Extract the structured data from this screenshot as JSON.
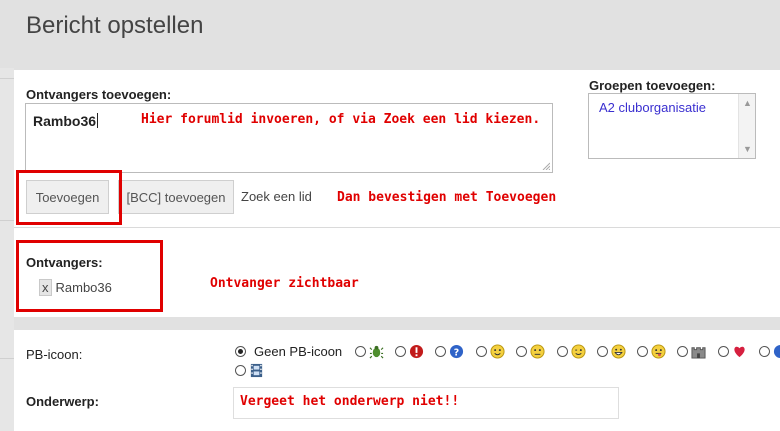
{
  "header": {
    "title": "Bericht opstellen"
  },
  "recipients_form": {
    "label": "Ontvangers toevoegen:",
    "input_value": "Rambo36",
    "add_button": "Toevoegen",
    "bcc_button": "[BCC] toevoegen",
    "search_link": "Zoek een lid"
  },
  "groups": {
    "label": "Groepen toevoegen:",
    "options": [
      "A2 cluborganisatie"
    ]
  },
  "recipients_list": {
    "label": "Ontvangers:",
    "items": [
      {
        "remove": "x",
        "name": "Rambo36"
      }
    ]
  },
  "annotations": {
    "input_hint": "Hier forumlid invoeren, of via Zoek een lid kiezen.",
    "confirm_hint": "Dan bevestigen met Toevoegen",
    "visible_hint": "Ontvanger zichtbaar",
    "subject_hint": "Vergeet het onderwerp niet!!",
    "accent_color": "#e00000"
  },
  "pm_icon": {
    "label": "PB-icoon:",
    "no_icon_label": "Geen PB-icoon",
    "selected": "Geen PB-icoon",
    "icons": [
      "bug-icon",
      "exclamation-icon",
      "question-icon",
      "smile-icon",
      "neutral-icon",
      "wink-icon",
      "grin-icon",
      "tongue-icon",
      "castle-icon",
      "heart-icon",
      "info-icon",
      "film-icon"
    ]
  },
  "subject": {
    "label": "Onderwerp:"
  }
}
